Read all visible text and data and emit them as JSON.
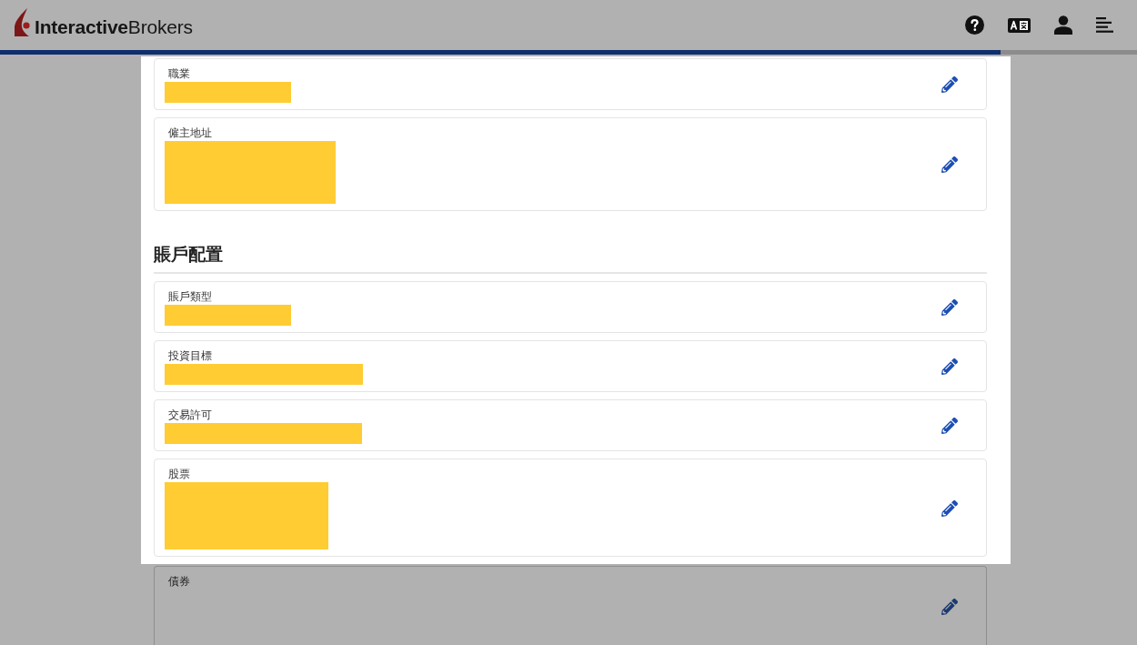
{
  "header": {
    "logo_text": "**Interactive**Brokers"
  },
  "progress": {
    "level": 0.88
  },
  "sections": [
    {
      "fields": [
        {
          "label": "職業",
          "redacted": true,
          "highlighted": true
        },
        {
          "label": "僱主地址",
          "redacted": true,
          "highlighted": true
        }
      ]
    },
    {
      "title": "賬戶配置",
      "highlighted": true,
      "fields": [
        {
          "label": "賬戶類型",
          "redacted": true,
          "highlighted": true
        },
        {
          "label": "投資目標",
          "redacted": true,
          "highlighted": true
        },
        {
          "label": "交易許可",
          "redacted": true,
          "highlighted": true
        },
        {
          "label": "股票",
          "redacted": true,
          "highlighted": true
        },
        {
          "label": "債券",
          "redacted": false,
          "highlighted": false
        }
      ]
    }
  ]
}
